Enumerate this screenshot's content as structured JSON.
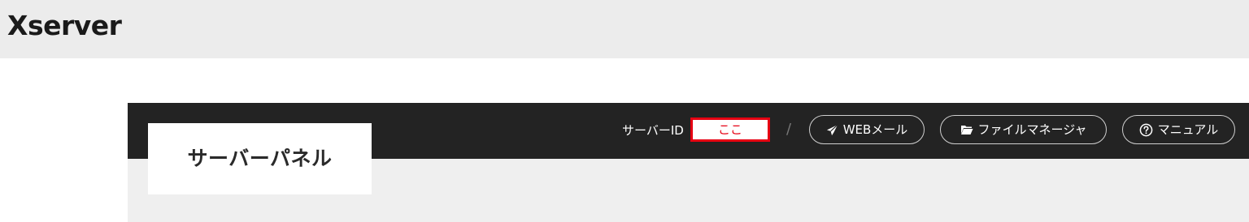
{
  "header": {
    "logo_text": "Xserver"
  },
  "panel": {
    "title": "サーバーパネル",
    "server_id_label": "サーバーID",
    "server_id_value": "ここ",
    "separator": "/",
    "buttons": {
      "webmail": {
        "label": "WEBメール",
        "icon": "paper-plane-icon"
      },
      "file_manager": {
        "label": "ファイルマネージャ",
        "icon": "folder-icon"
      },
      "manual": {
        "label": "マニュアル",
        "icon": "question-circle-icon"
      }
    }
  },
  "colors": {
    "topbar_bg": "#ececec",
    "panel_header_bg": "#232323",
    "highlight_border": "#e60012"
  }
}
